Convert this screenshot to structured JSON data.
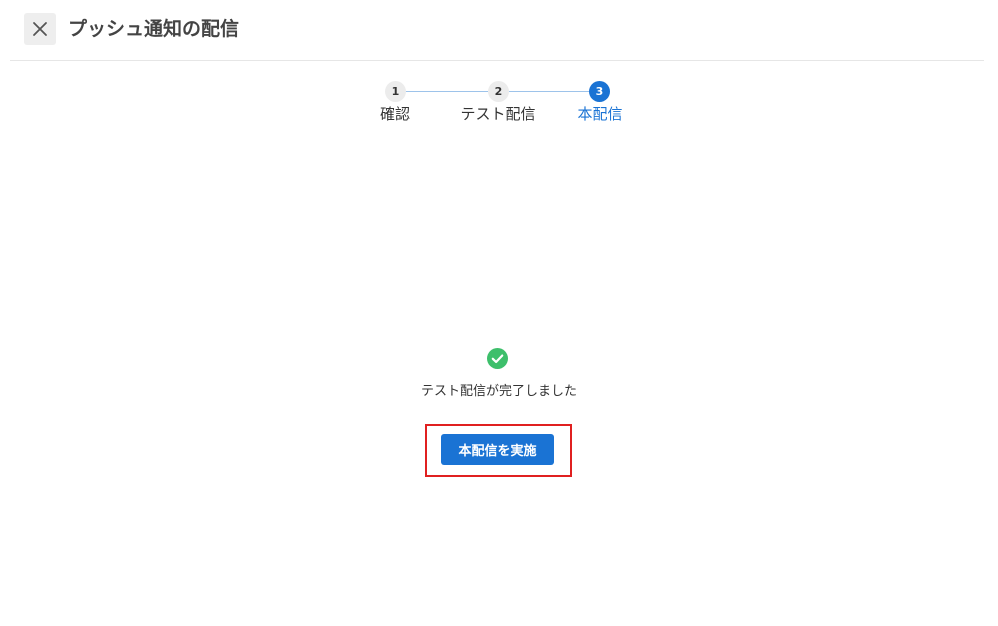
{
  "header": {
    "title": "プッシュ通知の配信",
    "close_icon": "close-icon"
  },
  "stepper": {
    "steps": [
      {
        "number": "1",
        "label": "確認",
        "state": "done"
      },
      {
        "number": "2",
        "label": "テスト配信",
        "state": "done"
      },
      {
        "number": "3",
        "label": "本配信",
        "state": "active"
      }
    ],
    "current_step": 3
  },
  "main": {
    "status_icon": "check-circle-icon",
    "status_text": "テスト配信が完了しました",
    "primary_button_label": "本配信を実施"
  },
  "colors": {
    "accent": "#1a73d4",
    "success": "#3dbf6b",
    "highlight": "#e02020"
  }
}
